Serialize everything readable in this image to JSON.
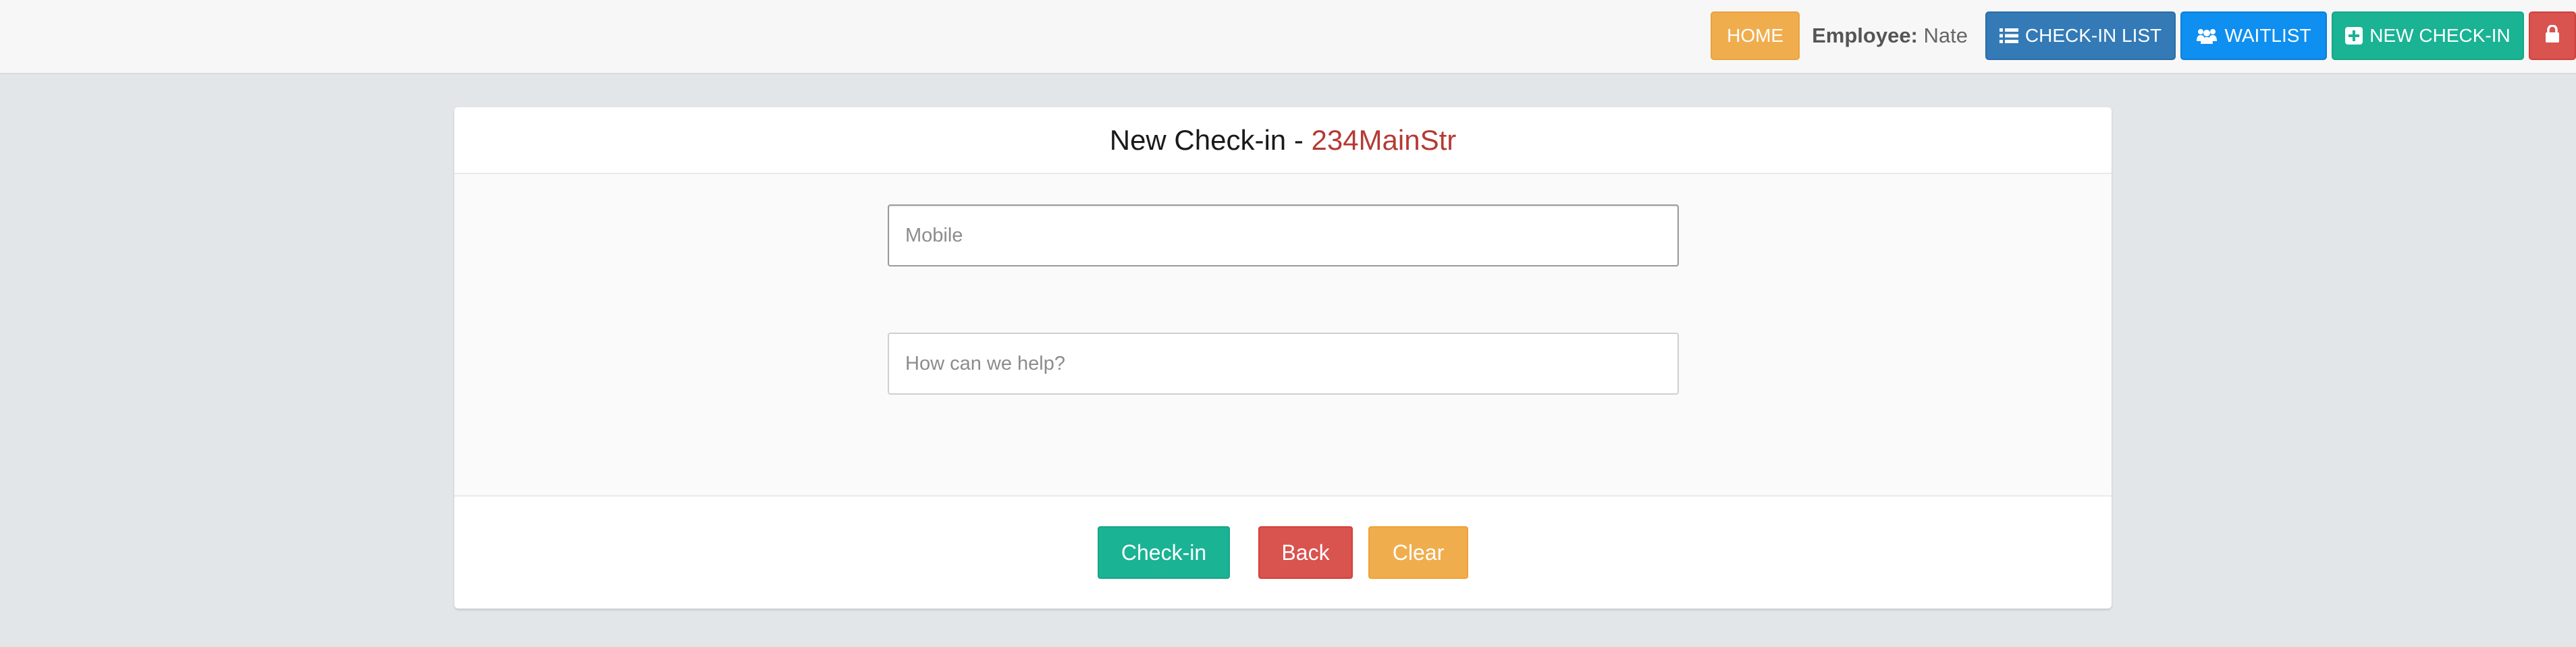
{
  "topbar": {
    "home_label": "HOME",
    "employee_label": "Employee:",
    "employee_name": "Nate",
    "checkin_list_label": "CHECK-IN LIST",
    "waitlist_label": "WAITLIST",
    "new_checkin_label": "NEW CHECK-IN",
    "icons": [
      "list-icon",
      "users-icon",
      "plus-square-icon",
      "lock-icon"
    ]
  },
  "card": {
    "title_prefix": "New Check-in - ",
    "store_name": "234MainStr",
    "mobile_placeholder": "Mobile",
    "mobile_value": "",
    "help_placeholder": "How can we help?",
    "help_value": ""
  },
  "footer": {
    "checkin_label": "Check-in",
    "back_label": "Back",
    "clear_label": "Clear"
  },
  "colors": {
    "background": "#e3e6e9",
    "home": "#f0ad4e",
    "checkin_list": "#337ab7",
    "waitlist": "#0f8fef",
    "new_checkin": "#1ab394",
    "lock": "#d9534f",
    "store_name": "#b53a34"
  }
}
